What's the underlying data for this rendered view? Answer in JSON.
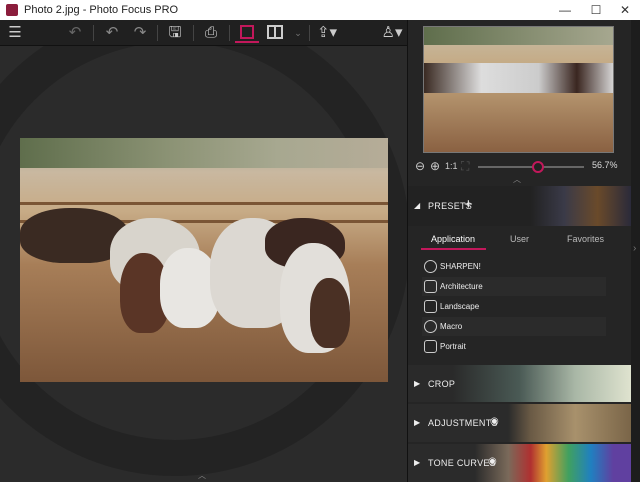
{
  "window": {
    "title": "Photo 2.jpg - Photo Focus PRO",
    "controls": [
      "—",
      "☐",
      "✕"
    ]
  },
  "toolbar": {
    "icons": [
      "menu-icon",
      "undo-all-icon",
      "undo-icon",
      "redo-icon",
      "save-icon",
      "print-icon",
      "single-view-icon",
      "split-view-icon",
      "dropdown-icon",
      "share-icon",
      "user-icon"
    ]
  },
  "navigator": {
    "zoom_value": "56.7%",
    "zoom_level_percent": 56.7,
    "one_to_one": "1:1"
  },
  "presets": {
    "title": "PRESETS",
    "tabs": [
      "Application",
      "User",
      "Favorites"
    ],
    "active_tab": "Application",
    "items": [
      {
        "label": "SHARPEN!"
      },
      {
        "label": "Architecture"
      },
      {
        "label": "Landscape"
      },
      {
        "label": "Macro"
      },
      {
        "label": "Portrait"
      }
    ]
  },
  "sections": [
    {
      "label": "CROP"
    },
    {
      "label": "ADJUSTMENTS"
    },
    {
      "label": "TONE CURVES"
    }
  ],
  "colors": {
    "accent": "#c2185b"
  }
}
